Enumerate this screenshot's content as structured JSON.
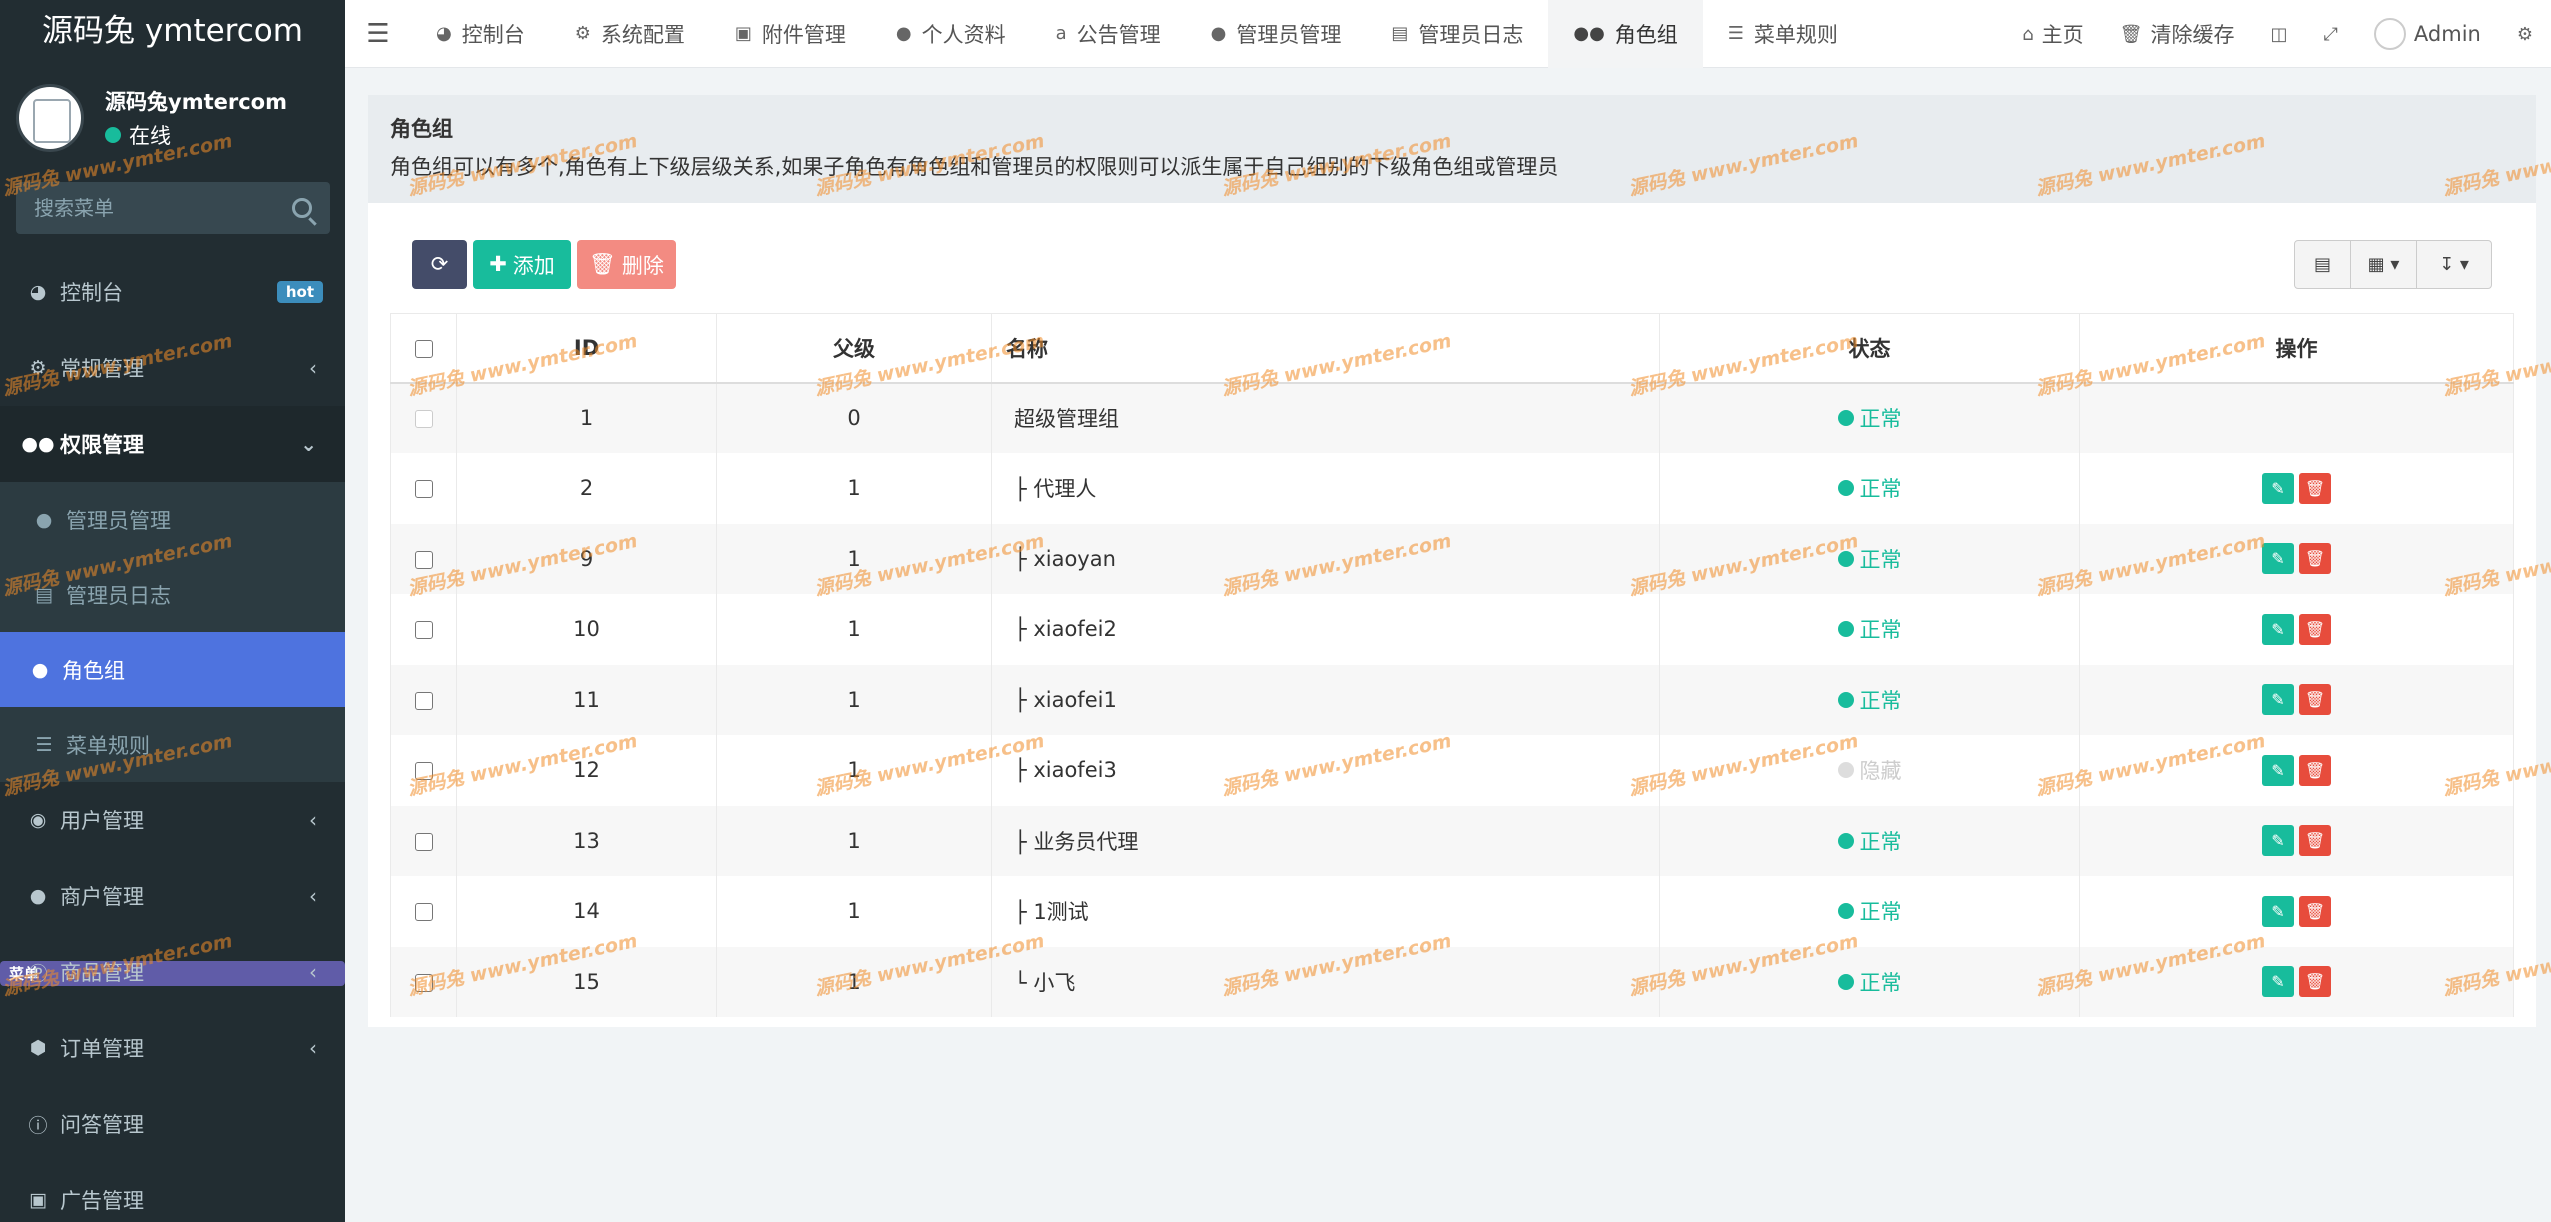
{
  "brand": "源码兔 ymtercom",
  "user": {
    "name": "源码兔ymtercom",
    "status": "在线"
  },
  "search": {
    "placeholder": "搜索菜单"
  },
  "sidebar": {
    "items": [
      {
        "label": "控制台",
        "icon": "dashboard-icon",
        "badge": "hot"
      },
      {
        "label": "常规管理",
        "icon": "cogs-icon"
      },
      {
        "label": "权限管理",
        "icon": "group-icon"
      },
      {
        "label": "用户管理",
        "icon": "user-circle-icon"
      },
      {
        "label": "商户管理",
        "icon": "apple-icon"
      },
      {
        "label": "商品管理",
        "icon": "product-icon"
      },
      {
        "label": "订单管理",
        "icon": "cube-icon"
      },
      {
        "label": "问答管理",
        "icon": "question-icon"
      },
      {
        "label": "广告管理",
        "icon": "ad-icon"
      }
    ],
    "sub": [
      {
        "label": "管理员管理",
        "icon": "user-icon"
      },
      {
        "label": "管理员日志",
        "icon": "list-alt-icon"
      },
      {
        "label": "角色组",
        "icon": "group-icon"
      },
      {
        "label": "菜单规则",
        "icon": "bars-icon",
        "badge": "菜单"
      }
    ]
  },
  "topnav": {
    "tabs": [
      {
        "label": "控制台",
        "icon": "dashboard-icon"
      },
      {
        "label": "系统配置",
        "icon": "cog-icon"
      },
      {
        "label": "附件管理",
        "icon": "image-icon"
      },
      {
        "label": "个人资料",
        "icon": "user-icon"
      },
      {
        "label": "公告管理",
        "icon": "amazon-icon"
      },
      {
        "label": "管理员管理",
        "icon": "user-icon"
      },
      {
        "label": "管理员日志",
        "icon": "list-alt-icon"
      },
      {
        "label": "角色组",
        "icon": "group-icon"
      },
      {
        "label": "菜单规则",
        "icon": "bars-icon"
      }
    ],
    "home": "主页",
    "clear_cache": "清除缓存",
    "admin": "Admin"
  },
  "page": {
    "title": "角色组",
    "desc": "角色组可以有多个,角色有上下级层级关系,如果子角色有角色组和管理员的权限则可以派生属于自己组别的下级角色组或管理员"
  },
  "toolbar": {
    "add": "添加",
    "delete": "删除"
  },
  "table": {
    "headers": {
      "id": "ID",
      "parent": "父级",
      "name": "名称",
      "status": "状态",
      "ops": "操作"
    },
    "rows": [
      {
        "id": "1",
        "parent": "0",
        "name": "超级管理组",
        "status": "正常",
        "hidden": false,
        "ops": false
      },
      {
        "id": "2",
        "parent": "1",
        "name": "├ 代理人",
        "status": "正常",
        "hidden": false,
        "ops": true
      },
      {
        "id": "9",
        "parent": "1",
        "name": "├ xiaoyan",
        "status": "正常",
        "hidden": false,
        "ops": true
      },
      {
        "id": "10",
        "parent": "1",
        "name": "├ xiaofei2",
        "status": "正常",
        "hidden": false,
        "ops": true
      },
      {
        "id": "11",
        "parent": "1",
        "name": "├ xiaofei1",
        "status": "正常",
        "hidden": false,
        "ops": true
      },
      {
        "id": "12",
        "parent": "1",
        "name": "├ xiaofei3",
        "status": "隐藏",
        "hidden": true,
        "ops": true
      },
      {
        "id": "13",
        "parent": "1",
        "name": "├ 业务员代理",
        "status": "正常",
        "hidden": false,
        "ops": true
      },
      {
        "id": "14",
        "parent": "1",
        "name": "├ 1测试",
        "status": "正常",
        "hidden": false,
        "ops": true
      },
      {
        "id": "15",
        "parent": "1",
        "name": "└ 小飞",
        "status": "正常",
        "hidden": false,
        "ops": true
      }
    ]
  },
  "watermark": "源码兔  www.ymter.com",
  "colors": {
    "sidebar": "#222d32",
    "active": "#4e73df",
    "success": "#18bc9c",
    "danger": "#e74c3c"
  }
}
